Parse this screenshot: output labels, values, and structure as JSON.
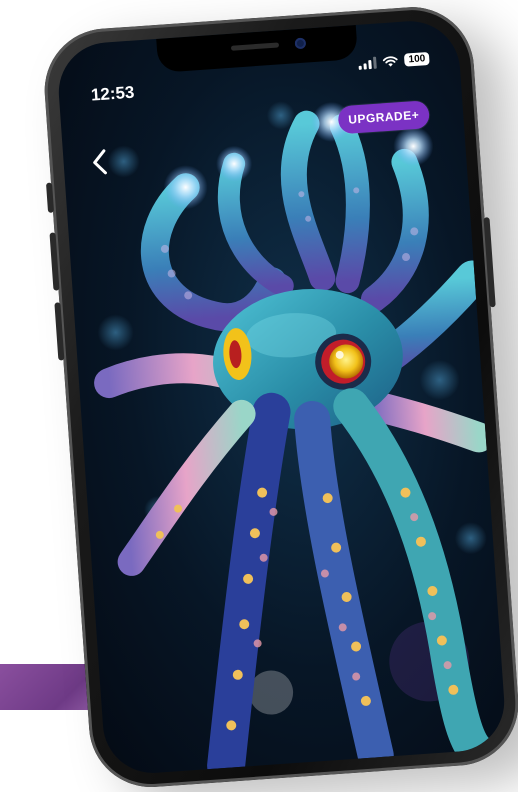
{
  "status_bar": {
    "time": "12:53",
    "battery_level": "100",
    "icons": [
      "signal-icon",
      "wifi-icon",
      "battery-icon"
    ]
  },
  "header": {
    "back_icon": "chevron-left-icon",
    "upgrade_label": "UPGRADE+"
  },
  "content": {
    "artwork": "octopus-artwork"
  },
  "colors": {
    "upgrade_bg": "#7b32c4",
    "screen_bg": "#071626",
    "octopus_teal": "#2fa0b8",
    "eye_gold": "#f2c21a"
  }
}
